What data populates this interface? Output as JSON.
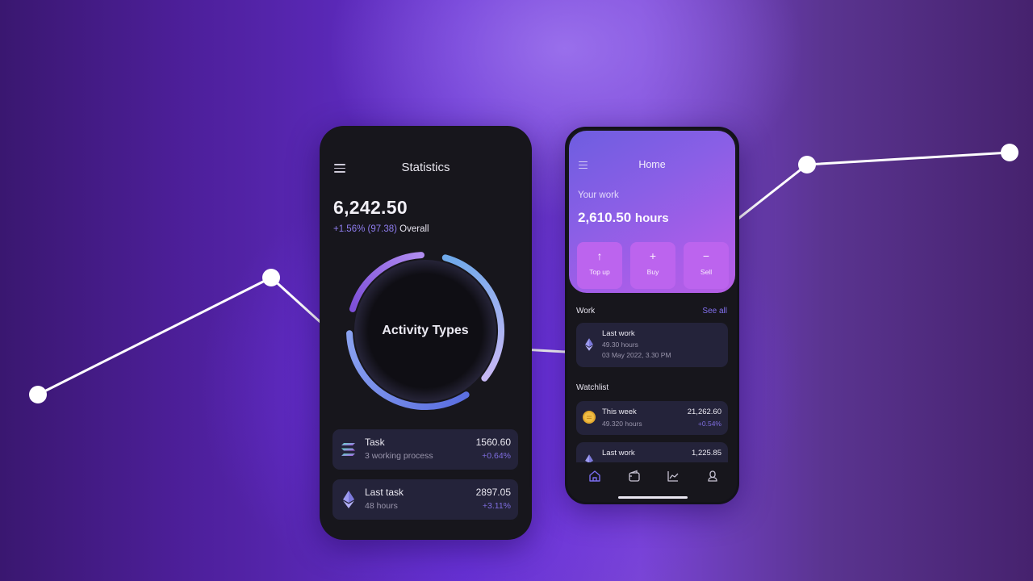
{
  "colors": {
    "accent": "#8370ee",
    "positive": "#7f6ee0",
    "phone_bg": "#17161c",
    "card_bg": "#24233a",
    "hero_gradient_start": "#6e5de0",
    "hero_gradient_end": "#b65ee6",
    "action_button": "#bc64ee",
    "background_line": "#ffffff"
  },
  "background_chart": {
    "type": "line",
    "points_visible": 5,
    "description": "Decorative upward-trending line with white point markers behind the phones"
  },
  "statistics_screen": {
    "menu_icon": "hamburger-icon",
    "title": "Statistics",
    "total": "6,242.50",
    "change": "+1.56% (97.38)",
    "change_label": "Overall",
    "ring_label": "Activity Types",
    "ring_segments": [
      {
        "name": "segment-1",
        "fraction": 0.34,
        "color_start": "#6fa9ea",
        "color_end": "#c7b8f5"
      },
      {
        "name": "segment-2",
        "fraction": 0.36,
        "color_start": "#5b6fe0",
        "color_end": "#8aa2f0"
      },
      {
        "name": "segment-3",
        "fraction": 0.22,
        "color_start": "#7d4fd8",
        "color_end": "#b08cf0"
      }
    ],
    "items": [
      {
        "icon": "solana-icon",
        "title": "Task",
        "subtitle": "3 working process",
        "value": "1560.60",
        "change": "+0.64%"
      },
      {
        "icon": "ethereum-icon",
        "title": "Last task",
        "subtitle": "48 hours",
        "value": "2897.05",
        "change": "+3.11%"
      }
    ]
  },
  "home_screen": {
    "menu_icon": "hamburger-icon",
    "title": "Home",
    "work_label": "Your work",
    "work_amount": "2,610.50",
    "work_unit": "hours",
    "actions": [
      {
        "glyph": "↑",
        "icon": "arrow-up-icon",
        "label": "Top up"
      },
      {
        "glyph": "+",
        "icon": "plus-icon",
        "label": "Buy"
      },
      {
        "glyph": "−",
        "icon": "minus-icon",
        "label": "Sell"
      }
    ],
    "work_section": {
      "label": "Work",
      "see_all": "See all",
      "item": {
        "icon": "ethereum-icon",
        "title": "Last work",
        "line1": "49.30 hours",
        "line2": "03 May 2022, 3.30 PM"
      }
    },
    "watchlist": {
      "label": "Watchlist",
      "items": [
        {
          "icon": "coin-icon",
          "title": "This week",
          "subtitle": "49.320 hours",
          "value": "21,262.60",
          "change": "+0.54%"
        },
        {
          "icon": "ethereum-icon",
          "title": "Last work",
          "subtitle": "",
          "value": "1,225.85",
          "change": ""
        }
      ]
    },
    "bottom_nav": [
      {
        "icon": "home-icon",
        "active": true
      },
      {
        "icon": "wallet-icon",
        "active": false
      },
      {
        "icon": "chart-icon",
        "active": false
      },
      {
        "icon": "profile-icon",
        "active": false
      }
    ]
  }
}
